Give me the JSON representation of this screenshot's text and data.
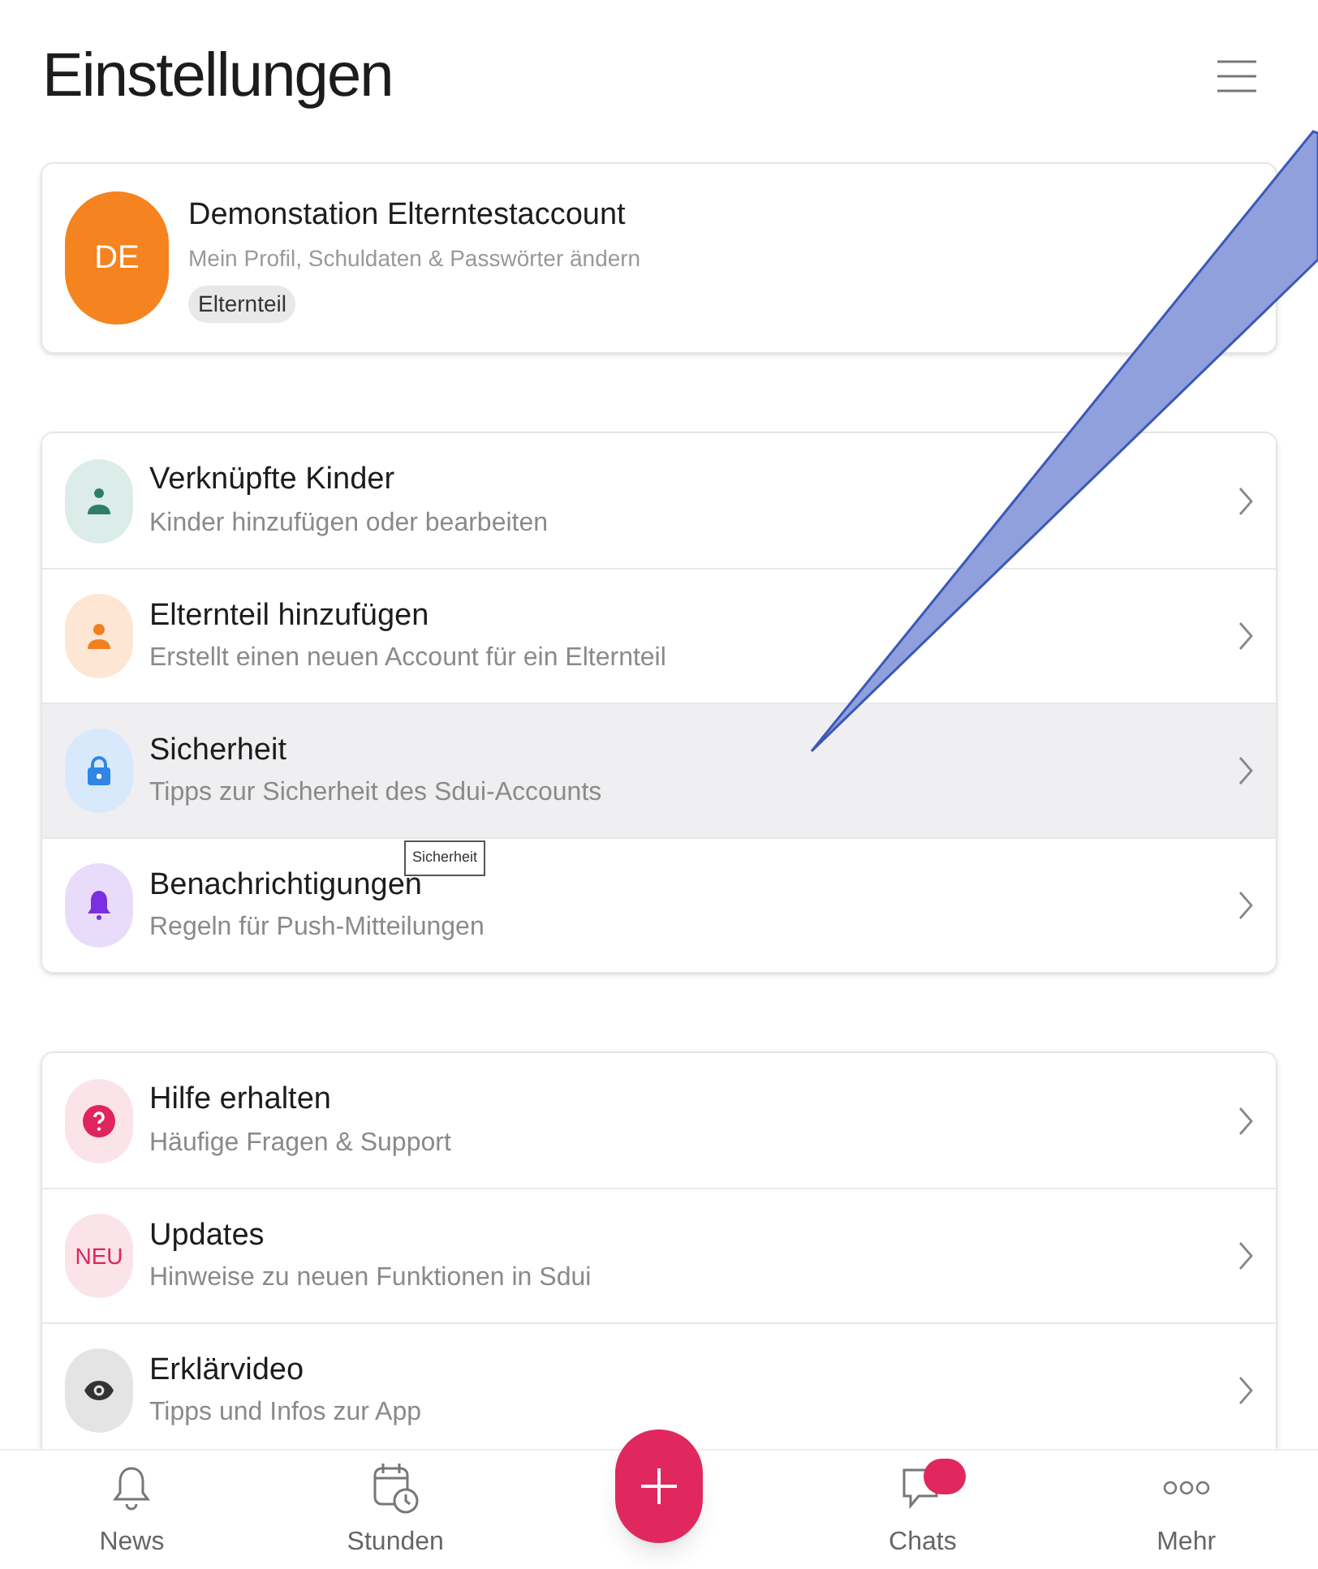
{
  "title": "Einstellungen",
  "profile": {
    "initials": "DE",
    "name": "Demonstation Elterntestaccount",
    "subtitle": "Mein Profil, Schuldaten & Passwörter ändern",
    "role": "Elternteil"
  },
  "groups": [
    {
      "items": [
        {
          "kind": "child",
          "title": "Verknüpfte Kinder",
          "subtitle": "Kinder hinzufügen oder bearbeiten",
          "selected": false
        },
        {
          "kind": "parent",
          "title": "Elternteil hinzufügen",
          "subtitle": "Erstellt einen neuen Account für ein Elternteil",
          "selected": false
        },
        {
          "kind": "lock",
          "title": "Sicherheit",
          "subtitle": "Tipps zur Sicherheit des Sdui-Accounts",
          "selected": true
        },
        {
          "kind": "bell",
          "title": "Benachrichtigungen",
          "subtitle": "Regeln für Push-Mitteilungen",
          "selected": false
        }
      ]
    },
    {
      "items": [
        {
          "kind": "help",
          "title": "Hilfe erhalten",
          "subtitle": "Häufige Fragen & Support",
          "selected": false
        },
        {
          "kind": "badge",
          "badge": "NEU",
          "title": "Updates",
          "subtitle": "Hinweise zu neuen Funktionen in Sdui",
          "selected": false
        },
        {
          "kind": "eye",
          "title": "Erklärvideo",
          "subtitle": "Tipps und Infos zur App",
          "selected": false
        }
      ]
    }
  ],
  "tooltip": "Sicherheit",
  "nav": [
    {
      "kind": "bell",
      "label": "News",
      "unread": false
    },
    {
      "kind": "calendar",
      "label": "Stunden",
      "unread": false
    },
    {
      "kind": "add"
    },
    {
      "kind": "chat",
      "label": "Chats",
      "unread": true
    },
    {
      "kind": "more",
      "label": "Mehr",
      "unread": false
    }
  ]
}
